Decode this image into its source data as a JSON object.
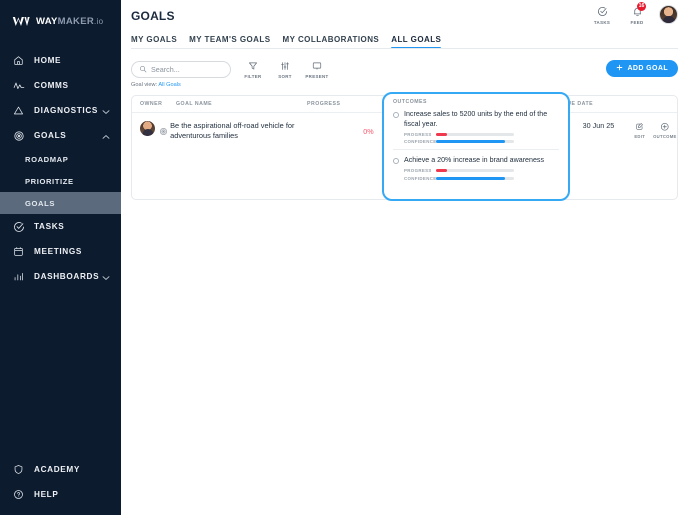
{
  "sidebar": {
    "brand": {
      "part1": "WAY",
      "part2": "MAKER",
      "part3": ".io"
    },
    "items": [
      {
        "label": "HOME",
        "icon": "home-icon",
        "expandable": false
      },
      {
        "label": "COMMS",
        "icon": "pulse-icon",
        "expandable": false
      },
      {
        "label": "DIAGNOSTICS",
        "icon": "triangle-icon",
        "expandable": true
      },
      {
        "label": "GOALS",
        "icon": "target-icon",
        "expandable": true
      }
    ],
    "sub_items": [
      {
        "label": "ROADMAP",
        "active": false
      },
      {
        "label": "PRIORITIZE",
        "active": false
      },
      {
        "label": "GOALS",
        "active": true
      }
    ],
    "items_after": [
      {
        "label": "TASKS",
        "icon": "check-circle-icon",
        "expandable": false
      },
      {
        "label": "MEETINGS",
        "icon": "calendar-icon",
        "expandable": false
      },
      {
        "label": "DASHBOARDS",
        "icon": "bar-chart-icon",
        "expandable": true
      }
    ],
    "bottom_items": [
      {
        "label": "ACADEMY",
        "icon": "shield-icon"
      },
      {
        "label": "HELP",
        "icon": "question-circle-icon"
      }
    ]
  },
  "header": {
    "title": "GOALS",
    "tasks_label": "TASKS",
    "feed_label": "FEED",
    "feed_badge": "16"
  },
  "tabs": [
    {
      "label": "MY GOALS",
      "active": false
    },
    {
      "label": "MY TEAM'S GOALS",
      "active": false
    },
    {
      "label": "MY COLLABORATIONS",
      "active": false
    },
    {
      "label": "ALL GOALS",
      "active": true
    }
  ],
  "toolbar": {
    "search_placeholder": "Search...",
    "search_value": "",
    "filter_label": "FILTER",
    "sort_label": "SORT",
    "present_label": "PRESENT",
    "add_goal_label": "ADD GOAL"
  },
  "goal_view": {
    "prefix": "Goal view:",
    "value": "All Goals"
  },
  "table": {
    "headers": {
      "owner": "OWNER",
      "goal_name": "GOAL NAME",
      "progress": "PROGRESS",
      "outcomes": "OUTCOMES",
      "due_date": "DUE DATE"
    },
    "rows": [
      {
        "goal_name": "Be the aspirational off-road vehicle for adventurous families",
        "progress": "0%",
        "due_date": "30 Jun 25",
        "edit_label": "EDIT",
        "outcome_label": "OUTCOME",
        "outcomes": [
          {
            "title": "Increase sales to 5200 units by the end of the fiscal year.",
            "progress_label": "PROGRESS",
            "confidence_label": "CONFIDENCE",
            "progress_pct": 14,
            "confidence_pct": 88
          },
          {
            "title": "Achieve a 20% increase in brand awareness",
            "progress_label": "PROGRESS",
            "confidence_label": "CONFIDENCE",
            "progress_pct": 14,
            "confidence_pct": 88
          }
        ]
      }
    ]
  },
  "colors": {
    "sidebar_bg": "#0d1b2e",
    "accent_blue": "#1f96f3",
    "highlight_border": "#36a9f4",
    "progress_red": "#f0384f",
    "badge_red": "#e8192c"
  }
}
